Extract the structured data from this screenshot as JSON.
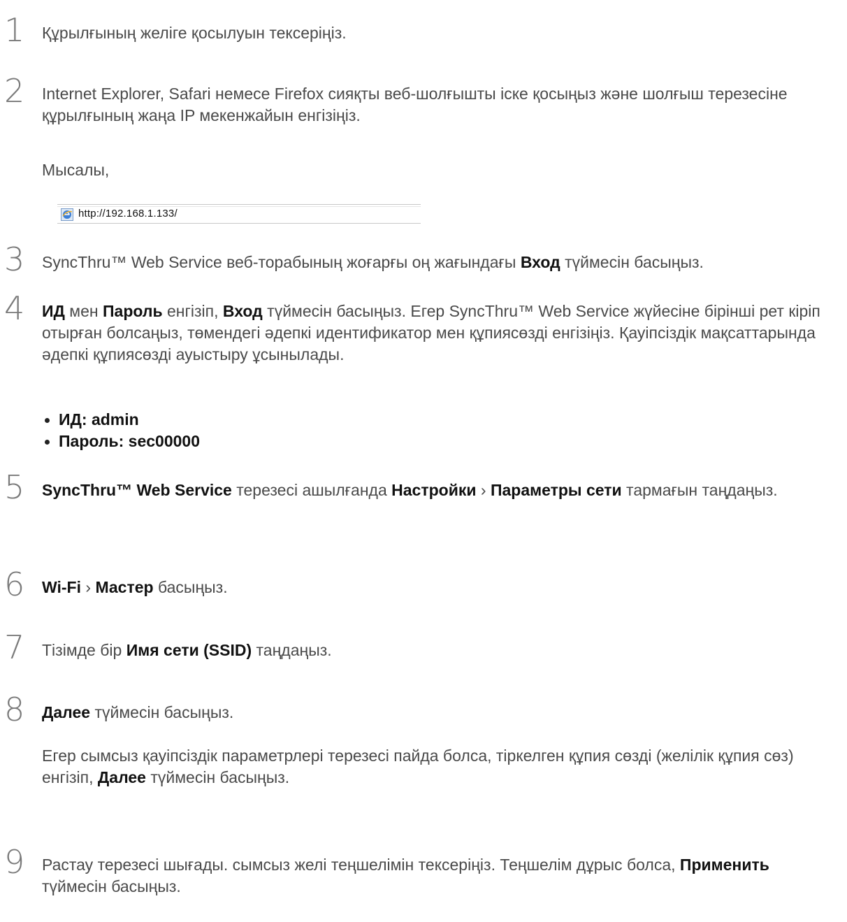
{
  "steps": [
    {
      "num": "1",
      "text": "Құрылғының желіге қосылуын тексеріңіз."
    },
    {
      "num": "2",
      "text": "Internet Explorer, Safari немесе Firefox сияқты веб-шолғышты іске қосыңыз және шолғыш терезесіне құрылғының жаңа IP мекенжайын енгізіңіз.",
      "example_label": "Мысалы,",
      "address_url": "http://192.168.1.133/"
    },
    {
      "num": "3",
      "text_before": "SyncThru™ Web Service веб-торабының жоғарғы оң жағындағы ",
      "bold": "Вход",
      "text_after": " түймесін басыңыз."
    },
    {
      "num": "4",
      "b1": "ИД",
      "t1": " мен ",
      "b2": "Пароль",
      "t2": " енгізіп, ",
      "b3": "Вход",
      "t3": " түймесін басыңыз. Егер SyncThru™ Web Service жүйесіне бірінші рет кіріп отырған болсаңыз, төмендегі әдепкі идентификатор мен құпиясөзді енгізіңіз. Қауіпсіздік мақсаттарында әдепкі құпиясөзді ауыстыру ұсынылады.",
      "bullets": [
        "ИД: admin",
        "Пароль: sec00000"
      ]
    },
    {
      "num": "5",
      "b1": "SyncThru™ Web Service",
      "t1": " терезесі ашылғанда ",
      "b2": "Настройки",
      "sep": " › ",
      "b3": "Параметры сети",
      "t2": " тармағын таңдаңыз."
    },
    {
      "num": "6",
      "b1": "Wi-Fi",
      "sep": " › ",
      "b2": "Мастер",
      "t1": " басыңыз."
    },
    {
      "num": "7",
      "t1": "Тізімде бір ",
      "b1": "Имя сети (SSID)",
      "t2": " таңдаңыз."
    },
    {
      "num": "8",
      "b1": "Далее",
      "t1": " түймесін басыңыз.",
      "sub_t1": "Егер сымсыз қауіпсіздік параметрлері терезесі пайда болса, тіркелген құпия сөзді (желілік құпия сөз) енгізіп, ",
      "sub_b1": "Далее",
      "sub_t2": " түймесін басыңыз."
    },
    {
      "num": "9",
      "t1": "Растау терезесі шығады. сымсыз желі теңшелімін тексеріңіз. Теңшелім дұрыс болса, ",
      "b1": "Применить",
      "t2": " түймесін басыңыз."
    }
  ]
}
